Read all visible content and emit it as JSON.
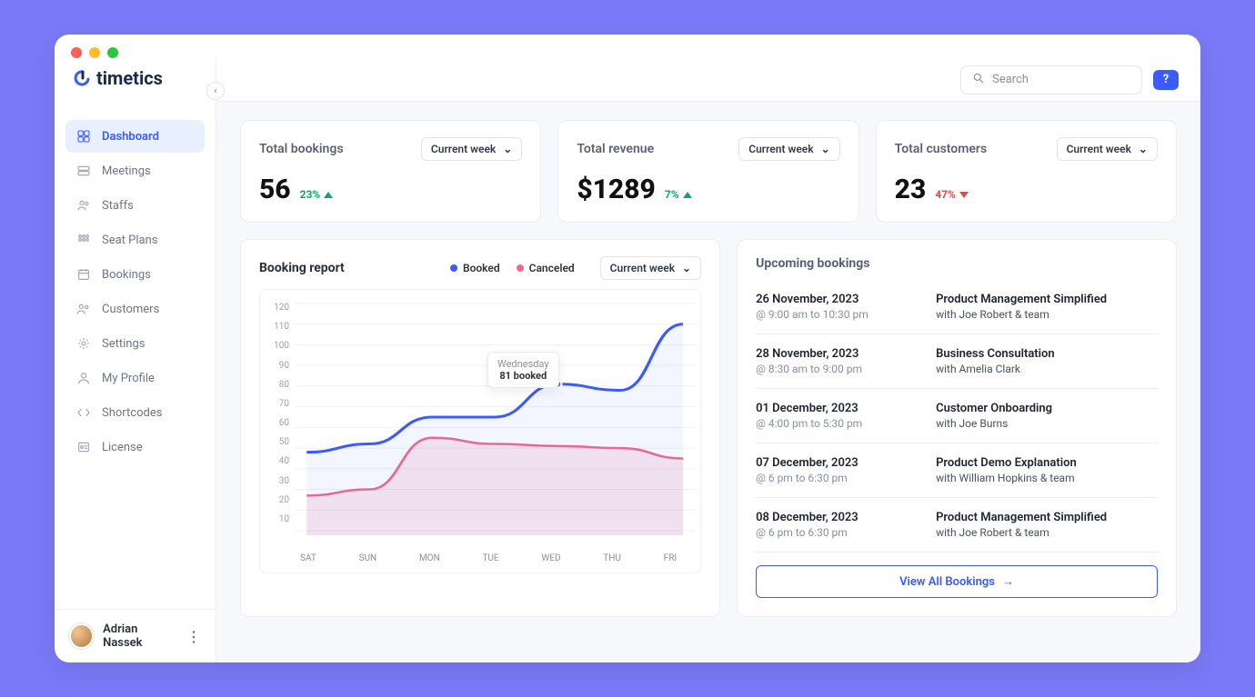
{
  "brand": "timetics",
  "search": {
    "placeholder": "Search"
  },
  "sidebar": {
    "items": [
      {
        "label": "Dashboard",
        "icon": "dashboard-icon",
        "active": true
      },
      {
        "label": "Meetings",
        "icon": "meetings-icon"
      },
      {
        "label": "Staffs",
        "icon": "staffs-icon"
      },
      {
        "label": "Seat Plans",
        "icon": "seat-plans-icon"
      },
      {
        "label": "Bookings",
        "icon": "bookings-icon"
      },
      {
        "label": "Customers",
        "icon": "customers-icon"
      },
      {
        "label": "Settings",
        "icon": "settings-icon"
      },
      {
        "label": "My Profile",
        "icon": "profile-icon"
      },
      {
        "label": "Shortcodes",
        "icon": "shortcodes-icon"
      },
      {
        "label": "License",
        "icon": "license-icon"
      }
    ],
    "user": "Adrian Nassek"
  },
  "stats": {
    "bookings": {
      "title": "Total bookings",
      "value": "56",
      "delta": "23%",
      "dir": "up",
      "period": "Current week"
    },
    "revenue": {
      "title": "Total revenue",
      "value": "$1289",
      "delta": "7%",
      "dir": "up",
      "period": "Current week"
    },
    "customers": {
      "title": "Total customers",
      "value": "23",
      "delta": "47%",
      "dir": "down",
      "period": "Current week"
    }
  },
  "report": {
    "title": "Booking report",
    "legend_booked": "Booked",
    "legend_canceled": "Canceled",
    "period": "Current week",
    "tooltip_day": "Wednesday",
    "tooltip_val": "81 booked"
  },
  "chart_data": {
    "type": "line",
    "categories": [
      "SAT",
      "SUN",
      "MON",
      "TUE",
      "WED",
      "THU",
      "FRI"
    ],
    "ylim": [
      10,
      120
    ],
    "yticks": [
      120,
      110,
      100,
      90,
      80,
      70,
      60,
      50,
      40,
      30,
      20,
      10
    ],
    "series": [
      {
        "name": "Booked",
        "color": "#3b5bff",
        "values": [
          48,
          52,
          65,
          65,
          81,
          78,
          110
        ]
      },
      {
        "name": "Canceled",
        "color": "#f36a8d",
        "values": [
          27,
          30,
          55,
          52,
          51,
          50,
          45
        ]
      }
    ]
  },
  "upcoming": {
    "title": "Upcoming bookings",
    "view_all": "View All Bookings",
    "items": [
      {
        "date": "26 November, 2023",
        "time": "@ 9:00 am to 10:30 pm",
        "title": "Product Management Simplified",
        "with": "with Joe Robert & team"
      },
      {
        "date": "28 November, 2023",
        "time": "@ 8:30 am to 9:00 pm",
        "title": "Business Consultation",
        "with": "with Amelia Clark"
      },
      {
        "date": "01 December, 2023",
        "time": "@ 4:00 pm to 5:30 pm",
        "title": "Customer Onboarding",
        "with": "with Joe Burns"
      },
      {
        "date": "07 December, 2023",
        "time": "@ 6 pm to 6:30 pm",
        "title": "Product Demo Explanation",
        "with": "with William Hopkins & team"
      },
      {
        "date": "08 December, 2023",
        "time": "@ 6 pm to 6:30 pm",
        "title": "Product Management Simplified",
        "with": "with Joe Robert & team"
      }
    ]
  }
}
